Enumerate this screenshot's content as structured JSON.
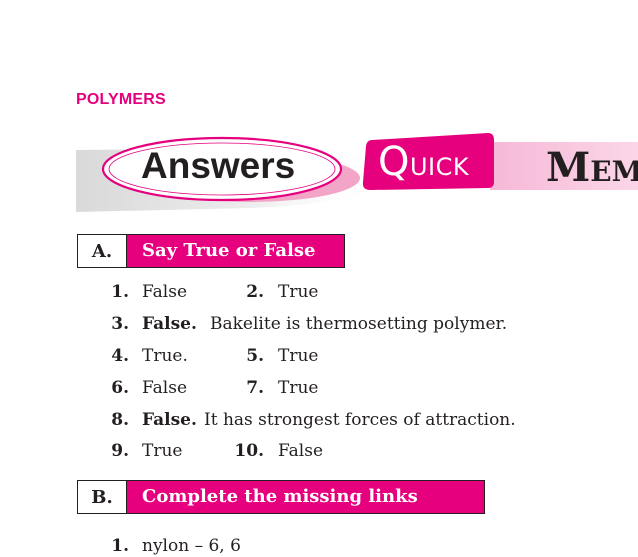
{
  "chapter": "POLYMERS",
  "banner": {
    "answers": "Answers",
    "quick_first": "Q",
    "quick_rest": "UICK",
    "mem_first": "M",
    "mem_rest": "EM"
  },
  "sectionA": {
    "letter": "A.",
    "title": "Say True or False",
    "items": {
      "n1": "1.",
      "a1": "False",
      "n2": "2.",
      "a2": "True",
      "n3": "3.",
      "a3_bold": "False.",
      "a3_rest": "Bakelite is thermosetting polymer.",
      "n4": "4.",
      "a4": "True.",
      "n5": "5.",
      "a5": "True",
      "n6": "6.",
      "a6": "False",
      "n7": "7.",
      "a7": "True",
      "n8": "8.",
      "a8_bold": "False.",
      "a8_rest": "It has strongest forces of attraction.",
      "n9": "9.",
      "a9": "True",
      "n10": "10.",
      "a10": "False"
    }
  },
  "sectionB": {
    "letter": "B.",
    "title": "Complete the missing links",
    "n1": "1.",
    "a1": "nylon – 6, 6"
  }
}
